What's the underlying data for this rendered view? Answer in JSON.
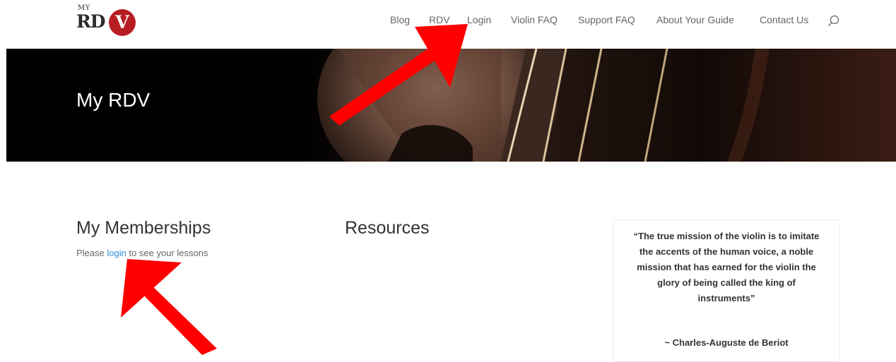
{
  "logo": {
    "my": "MY",
    "rd": "RD",
    "v": "V"
  },
  "nav": {
    "items": [
      "Blog",
      "RDV",
      "Login",
      "Violin FAQ",
      "Support FAQ",
      "About Your Guide",
      "Contact Us"
    ]
  },
  "hero": {
    "title": "My RDV"
  },
  "memberships": {
    "title": "My Memberships",
    "note_prefix": "Please ",
    "note_link": "login",
    "note_suffix": " to see your lessons"
  },
  "resources": {
    "title": "Resources"
  },
  "quote": {
    "text": "“The true mission of the violin is to imitate the accents of the human voice, a noble mission that has earned for the violin the glory of being called the king of instruments”",
    "author": "~ Charles-Auguste de Beriot"
  },
  "icons": {
    "search": "search-icon"
  },
  "colors": {
    "brand_red": "#b81d24",
    "link_blue": "#2e8fd6",
    "annotation_red": "#ff0000"
  }
}
